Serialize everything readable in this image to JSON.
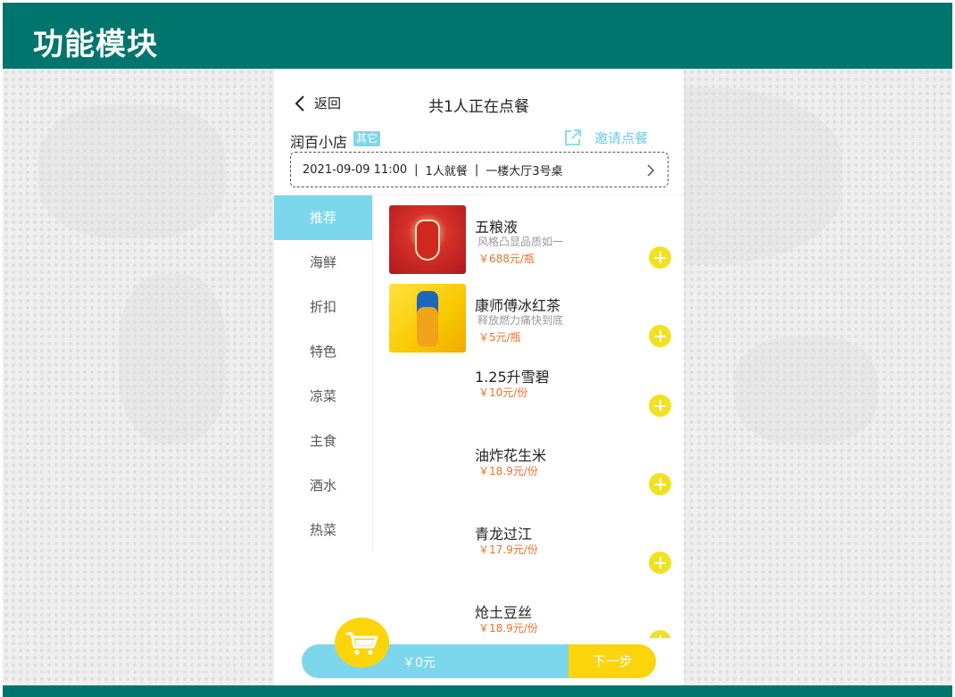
{
  "frame": {
    "title": "功能模块",
    "accent_color": "#00756d"
  },
  "nav": {
    "back_label": "返回",
    "title": "共1人正在点餐"
  },
  "store": {
    "name": "润百小店",
    "tag": "其它",
    "invite_label": "邀请点餐"
  },
  "order_info": {
    "datetime": "2021-09-09 11:00",
    "sep1": "|",
    "diners": "1人就餐",
    "sep2": "|",
    "table": "一楼大厅3号桌"
  },
  "categories": [
    "推荐",
    "海鲜",
    "折扣",
    "特色",
    "凉菜",
    "主食",
    "酒水",
    "热菜"
  ],
  "active_category": 0,
  "products": [
    {
      "name": "五粮液",
      "desc": "风格凸显品质如一",
      "price": "￥688元/瓶"
    },
    {
      "name": "康师傅冰红茶",
      "desc": "释放燃力痛快到底",
      "price": "￥5元/瓶"
    },
    {
      "name": "1.25升雪碧",
      "price": "￥10元/份"
    },
    {
      "name": "油炸花生米",
      "price": "￥18.9元/份"
    },
    {
      "name": "青龙过江",
      "price": "￥17.9元/份"
    },
    {
      "name": "炝土豆丝",
      "price": "￥18.9元/份"
    }
  ],
  "cart": {
    "total": "￥0元",
    "next_label": "下一步"
  },
  "colors": {
    "cyan": "#7dd7ec",
    "yellow": "#fbd40b",
    "add_button": "#f2e11f",
    "price": "#f26f2b"
  }
}
